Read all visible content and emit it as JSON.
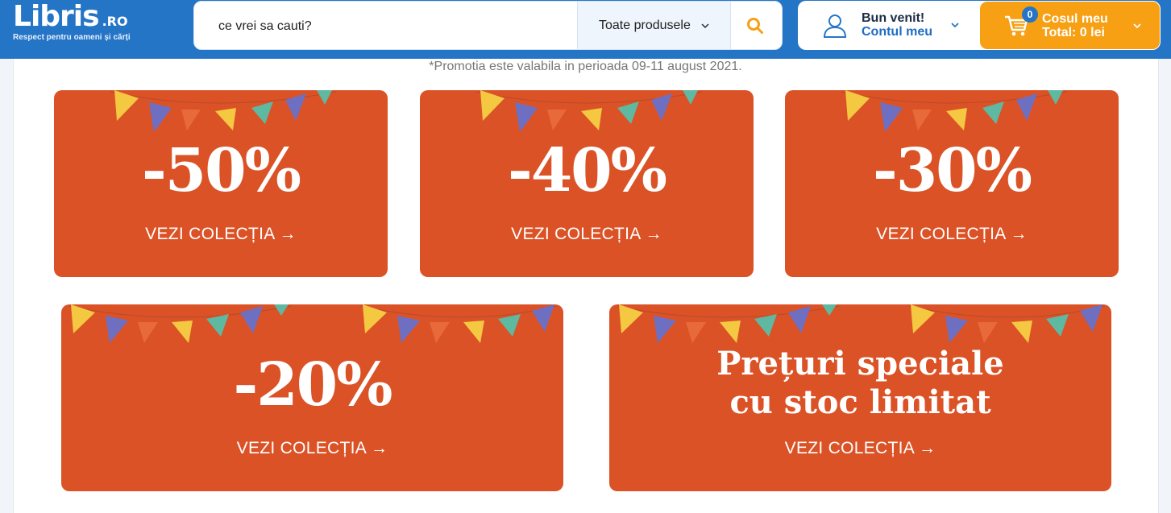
{
  "header": {
    "logo_word": "Libris",
    "logo_suffix": ".RO",
    "logo_tagline": "Respect pentru oameni și cărți",
    "search_placeholder": "ce vrei sa cauti?",
    "category_selected": "Toate produsele",
    "account_greeting": "Bun venit!",
    "account_link": "Contul meu",
    "cart_count": "0",
    "cart_title": "Cosul meu",
    "cart_total": "Total: 0 lei"
  },
  "promo_note": "*Promotia este valabila in perioada 09-11 august 2021.",
  "banners": [
    {
      "headline": "-50%",
      "cta": "VEZI COLECȚIA →"
    },
    {
      "headline": "-40%",
      "cta": "VEZI COLECȚIA →"
    },
    {
      "headline": "-30%",
      "cta": "VEZI COLECȚIA →"
    },
    {
      "headline": "-20%",
      "cta": "VEZI COLECȚIA →"
    },
    {
      "headline_line1": "Prețuri speciale",
      "headline_line2": "cu stoc limitat",
      "cta": "VEZI COLECȚIA →"
    }
  ],
  "colors": {
    "header_blue": "#2575c7",
    "banner_orange": "#db5226",
    "cart_orange": "#f7a014",
    "flag_yellow": "#f5c842",
    "flag_blue": "#6f6fc2",
    "flag_orange": "#e86a3a",
    "flag_teal": "#5fb8a0"
  }
}
